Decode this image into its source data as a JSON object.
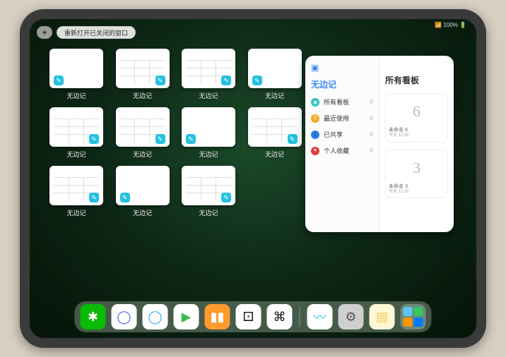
{
  "status": {
    "network": "📶",
    "battery": "100%",
    "battery_icon": "🔋"
  },
  "top": {
    "plus": "+",
    "reopen_label": "重新打开已关闭的窗口"
  },
  "windows": [
    {
      "label": "无边记",
      "variant": "blank"
    },
    {
      "label": "无边记",
      "variant": "calendar"
    },
    {
      "label": "无边记",
      "variant": "calendar"
    },
    {
      "label": "无边记",
      "variant": "blank"
    },
    {
      "label": "无边记",
      "variant": "calendar"
    },
    {
      "label": "无边记",
      "variant": "calendar"
    },
    {
      "label": "无边记",
      "variant": "blank"
    },
    {
      "label": "无边记",
      "variant": "calendar"
    },
    {
      "label": "无边记",
      "variant": "calendar"
    },
    {
      "label": "无边记",
      "variant": "blank"
    },
    {
      "label": "无边记",
      "variant": "calendar"
    }
  ],
  "panel": {
    "left_title": "无边记",
    "right_title": "所有看板",
    "more": "···",
    "sidebar": [
      {
        "icon_color": "#2dc2c2",
        "glyph": "◉",
        "label": "所有看板",
        "count": "0"
      },
      {
        "icon_color": "#f5a623",
        "glyph": "⏱",
        "label": "最近使用",
        "count": "0"
      },
      {
        "icon_color": "#2f7de1",
        "glyph": "👤",
        "label": "已共享",
        "count": "0"
      },
      {
        "icon_color": "#e23b3b",
        "glyph": "♥",
        "label": "个人收藏",
        "count": "0"
      }
    ],
    "boards": [
      {
        "sketch": "6",
        "title": "未命名 6",
        "subtitle": "今天 11:26"
      },
      {
        "sketch": "3",
        "title": "未命名 3",
        "subtitle": "今天 11:25"
      }
    ]
  },
  "dock": [
    {
      "name": "wechat",
      "bg": "#09bb07",
      "glyph": "✱",
      "glyph_color": "#fff"
    },
    {
      "name": "browser-1",
      "bg": "#ffffff",
      "glyph": "◯",
      "glyph_color": "#4a62f0"
    },
    {
      "name": "browser-2",
      "bg": "#ffffff",
      "glyph": "◯",
      "glyph_color": "#2aa6ff"
    },
    {
      "name": "play",
      "bg": "#ffffff",
      "glyph": "▶",
      "glyph_color": "#3bbb55"
    },
    {
      "name": "books",
      "bg": "#ff9a2e",
      "glyph": "▮▮",
      "glyph_color": "#fff"
    },
    {
      "name": "dice",
      "bg": "#ffffff",
      "glyph": "⚀",
      "glyph_color": "#111"
    },
    {
      "name": "nodes",
      "bg": "#ffffff",
      "glyph": "⌘",
      "glyph_color": "#111"
    },
    {
      "name": "sep"
    },
    {
      "name": "freeform",
      "bg": "#ffffff",
      "glyph": "〰",
      "glyph_color": "#28c3e6"
    },
    {
      "name": "settings",
      "bg": "#cfcfcf",
      "glyph": "⚙",
      "glyph_color": "#555"
    },
    {
      "name": "notes",
      "bg": "#fff8d8",
      "glyph": "▤",
      "glyph_color": "#f2c94c"
    },
    {
      "name": "folder",
      "type": "folder"
    }
  ]
}
